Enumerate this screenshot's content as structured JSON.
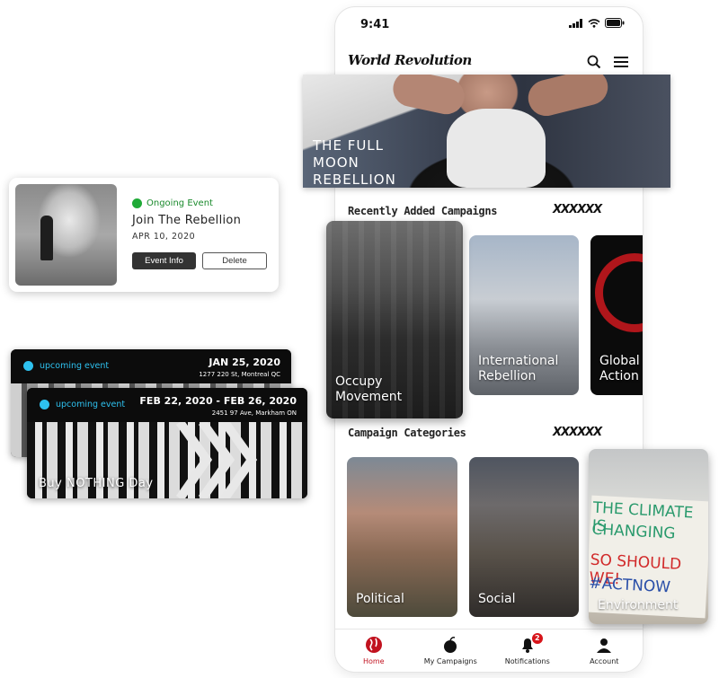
{
  "status_bar": {
    "time": "9:41"
  },
  "header": {
    "logo": "World Revolution"
  },
  "hero": {
    "title_lines": [
      "THE FULL",
      "MOON",
      "REBELLION"
    ]
  },
  "sections": {
    "recent": {
      "title": "Recently Added Campaigns",
      "scribble": "XXXXXX"
    },
    "categories": {
      "title": "Campaign Categories",
      "scribble": "XXXXXX"
    }
  },
  "campaigns": [
    {
      "lines": [
        "Occupy",
        "Movement"
      ]
    },
    {
      "lines": [
        "International",
        "Rebellion"
      ]
    },
    {
      "lines": [
        "Global",
        "Action"
      ]
    }
  ],
  "categories": [
    {
      "label": "Political"
    },
    {
      "label": "Social"
    },
    {
      "label": "Environment",
      "sign_lines": [
        "THE CLIMATE IS",
        "CHANGING",
        "SO SHOULD WE!",
        "#ACTNOW"
      ]
    }
  ],
  "bottom_nav": {
    "items": [
      {
        "label": "Home",
        "active": true
      },
      {
        "label": "My Campaigns"
      },
      {
        "label": "Notifications",
        "badge": "2"
      },
      {
        "label": "Account"
      }
    ]
  },
  "ongoing_event": {
    "status": "Ongoing Event",
    "title": "Join The Rebellion",
    "date": "APR 10, 2020",
    "primary_button": "Event Info",
    "secondary_button": "Delete"
  },
  "upcoming_events": [
    {
      "status": "upcoming event",
      "date": "JAN 25, 2020",
      "address": "1277 220 St, Montreal QC",
      "title": ""
    },
    {
      "status": "upcoming event",
      "date": "FEB 22, 2020 - FEB 26, 2020",
      "address": "2451 97 Ave, Markham ON",
      "title": "Buy NOTHING Day"
    }
  ],
  "colors": {
    "accent_red": "#c1121f",
    "ongoing_green": "#1faa37",
    "upcoming_blue": "#2ec1ef"
  }
}
